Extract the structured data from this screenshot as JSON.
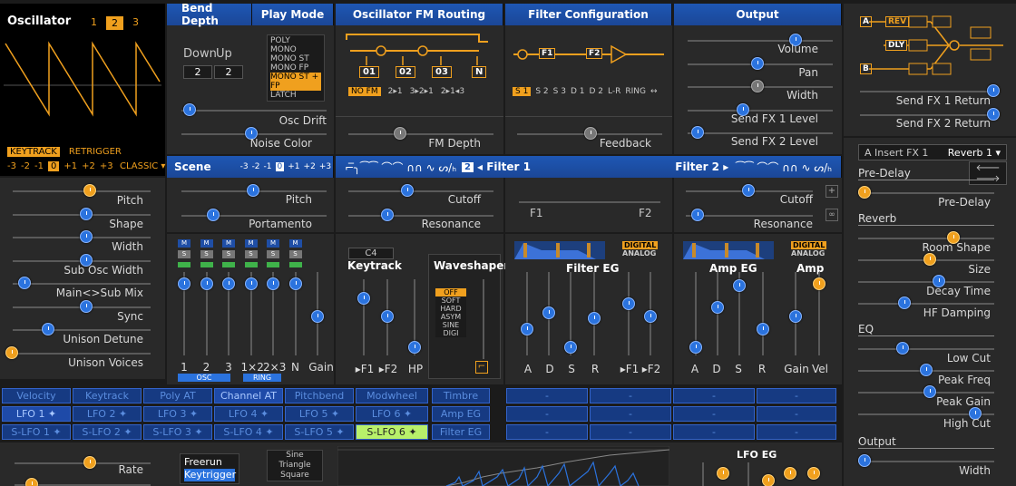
{
  "osc": {
    "title": "Oscillator",
    "nums": [
      "1",
      "2",
      "3"
    ],
    "keytrack": "KEYTRACK",
    "retrigger": "RETRIGGER",
    "octaves": [
      "-3",
      "-2",
      "-1",
      "0",
      "+1",
      "+2",
      "+3"
    ],
    "mode": "CLASSIC ▾"
  },
  "osc_params": [
    "Pitch",
    "Shape",
    "Width",
    "Sub Osc Width",
    "Main<>Sub Mix",
    "Sync",
    "Unison Detune",
    "Unison Voices"
  ],
  "bend": {
    "title": "Bend Depth",
    "down": "Down",
    "up": "Up",
    "down_val": "2",
    "up_val": "2"
  },
  "play": {
    "title": "Play Mode",
    "modes": [
      "POLY",
      "MONO",
      "MONO ST",
      "MONO FP",
      "MONO ST + FP",
      "LATCH"
    ],
    "selected": "MONO ST + FP"
  },
  "drift": {
    "osc_drift": "Osc Drift",
    "noise_color": "Noise Color"
  },
  "fm": {
    "title": "Oscillator FM Routing",
    "boxes": [
      "01",
      "02",
      "03",
      "N"
    ],
    "opts": [
      "NO FM",
      "2▸1",
      "3▸2▸1",
      "2▸1◂3"
    ],
    "selected": "NO FM",
    "depth": "FM Depth"
  },
  "filt": {
    "title": "Filter Configuration",
    "opts": [
      "S 1",
      "S 2",
      "S 3",
      "D 1",
      "D 2",
      "L-R",
      "RING",
      "↔"
    ],
    "selected": "S 1",
    "feedback": "Feedback",
    "blocks": [
      "F1",
      "F2"
    ]
  },
  "out": {
    "title": "Output",
    "params": [
      "Volume",
      "Pan",
      "Width",
      "Send FX 1 Level",
      "Send FX 2 Level"
    ]
  },
  "scene": {
    "title": "Scene",
    "octaves": [
      "-3",
      "-2",
      "-1",
      "0",
      "+1",
      "+2",
      "+3"
    ],
    "pitch": "Pitch",
    "portamento": "Portamento"
  },
  "filter_bar": {
    "types": "⌐̅╮⁀⁀ ⌒⌒ ∩∩ ∿ ᔕ/ₕ",
    "num": "2",
    "f1": "◂ Filter 1",
    "f2": "Filter 2 ▸",
    "types2": "⁀⁀ ⌒⌒ ∩∩ ∿ ᔕ/ₕ"
  },
  "filt1": {
    "cutoff": "Cutoff",
    "resonance": "Resonance"
  },
  "filt_mid": {
    "f1": "F1",
    "f2": "F2"
  },
  "filt2": {
    "cutoff": "Cutoff",
    "resonance": "Resonance"
  },
  "mixer": {
    "m": "M",
    "s": "S",
    "labels": [
      "1",
      "2",
      "3",
      "1×2",
      "2×3",
      "N",
      "Gain"
    ],
    "osc": "OSC",
    "ring": "RING"
  },
  "keytrack": {
    "note": "C4",
    "title": "Keytrack",
    "labels": [
      "▸F1",
      "▸F2",
      "HP"
    ]
  },
  "waveshaper": {
    "title": "Waveshaper",
    "opts": [
      "OFF",
      "SOFT",
      "HARD",
      "ASYM",
      "SINE",
      "DIGI"
    ],
    "selected": "OFF"
  },
  "filter_eg": {
    "title": "Filter EG",
    "digital": "DIGITAL",
    "analog": "ANALOG",
    "labels": [
      "A",
      "D",
      "S",
      "R",
      "▸F1",
      "▸F2"
    ]
  },
  "amp_eg": {
    "title": "Amp EG",
    "amp": "Amp",
    "digital": "DIGITAL",
    "analog": "ANALOG",
    "labels": [
      "A",
      "D",
      "S",
      "R",
      "Gain",
      "Vel"
    ]
  },
  "mod_row1": [
    "Velocity",
    "Keytrack",
    "Poly AT",
    "Channel AT",
    "Pitchbend",
    "Modwheel",
    "Timbre",
    "-",
    "-",
    "-",
    "-"
  ],
  "mod_row2": [
    "LFO 1 ✦",
    "LFO 2 ✦",
    "LFO 3 ✦",
    "LFO 4 ✦",
    "LFO 5 ✦",
    "LFO 6 ✦",
    "Amp EG",
    "-",
    "-",
    "-",
    "-"
  ],
  "mod_row3": [
    "S-LFO 1 ✦",
    "S-LFO 2 ✦",
    "S-LFO 3 ✦",
    "S-LFO 4 ✦",
    "S-LFO 5 ✦",
    "S-LFO 6 ✦",
    "Filter EG",
    "-",
    "-",
    "-",
    "-"
  ],
  "lfo": {
    "rate": "Rate",
    "modes": [
      "Freerun",
      "Keytrigger"
    ],
    "selected": "Keytrigger",
    "shapes": [
      "Sine",
      "Triangle",
      "Square"
    ],
    "eg": "LFO EG"
  },
  "fx": {
    "blocks": [
      "A",
      "REV",
      "DLY",
      "B"
    ],
    "ret1": "Send FX 1 Return",
    "ret2": "Send FX 2 Return",
    "slot": "A Insert FX 1",
    "type": "Reverb 1 ▾",
    "arrows": "🡐 🡒"
  },
  "fx_params": {
    "predelay_h": "Pre-Delay",
    "predelay": "Pre-Delay",
    "reverb_h": "Reverb",
    "room": "Room Shape",
    "size": "Size",
    "decay": "Decay Time",
    "hfd": "HF Damping",
    "eq_h": "EQ",
    "lowcut": "Low Cut",
    "peakf": "Peak Freq",
    "peakg": "Peak Gain",
    "highcut": "High Cut",
    "output_h": "Output",
    "width": "Width"
  }
}
